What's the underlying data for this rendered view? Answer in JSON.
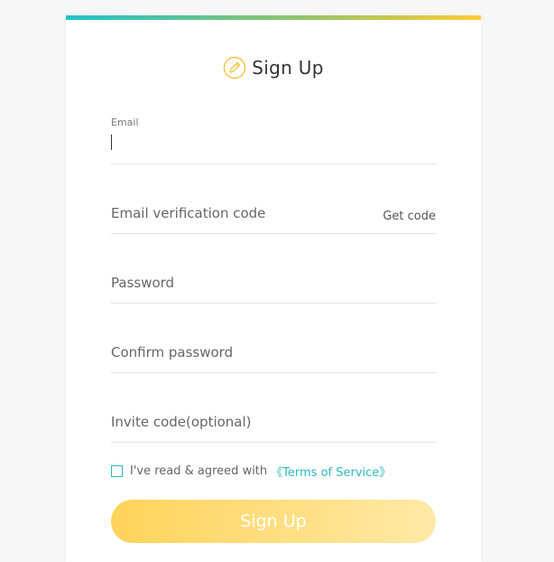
{
  "header": {
    "title": "Sign Up",
    "icon": "pencil-circle-icon"
  },
  "form": {
    "email": {
      "label": "Email",
      "value": ""
    },
    "verification_code": {
      "placeholder": "Email verification code",
      "get_code_label": "Get code"
    },
    "password": {
      "placeholder": "Password"
    },
    "confirm_password": {
      "placeholder": "Confirm password"
    },
    "invite_code": {
      "placeholder": "Invite code(optional)"
    },
    "agreement": {
      "text": "I've read & agreed with",
      "link_text": "《Terms of Service》",
      "checked": false
    },
    "submit_label": "Sign Up"
  },
  "colors": {
    "accent": "#2cb8bf",
    "button_start": "#ffd35a",
    "button_end": "#ffe9a6",
    "icon": "#f5c342"
  }
}
